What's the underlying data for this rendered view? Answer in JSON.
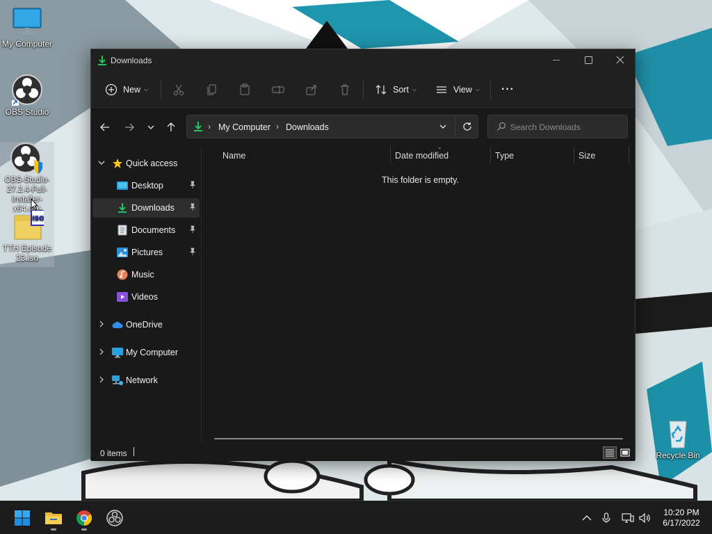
{
  "desktop": {
    "icons": [
      {
        "label": "My Computer",
        "icon": "monitor-icon"
      },
      {
        "label": "OBS Studio",
        "icon": "obs-icon"
      },
      {
        "label": "OBS-Studio-27.2.4-Full-Installer-x64.exe",
        "icon": "obs-installer-icon"
      },
      {
        "label": "TTH Episode 23.iso",
        "icon": "iso-file-icon"
      },
      {
        "label": "Recycle Bin",
        "icon": "recycle-bin-icon"
      }
    ],
    "selected_icon_label_visible": "OBS-Studio-2​7.2.4-Full-Inst​aller-x64.exe"
  },
  "explorer": {
    "title": "Downloads",
    "toolbar": {
      "new_label": "New",
      "sort_label": "Sort",
      "view_label": "View",
      "more_label": "···"
    },
    "address": {
      "segments": [
        "My Computer",
        "Downloads"
      ]
    },
    "search": {
      "placeholder": "Search Downloads"
    },
    "nav": {
      "quick_access": "Quick access",
      "pinned": [
        "Desktop",
        "Downloads",
        "Documents",
        "Pictures"
      ],
      "unpinned": [
        "Music",
        "Videos"
      ],
      "onedrive": "OneDrive",
      "my_computer": "My Computer",
      "network": "Network",
      "active": "Downloads"
    },
    "columns": [
      "Name",
      "Date modified",
      "Type",
      "Size"
    ],
    "empty_message": "This folder is empty.",
    "status": {
      "item_count": "0 items"
    }
  },
  "taskbar": {
    "apps": [
      "start-icon",
      "file-explorer-icon",
      "chrome-icon",
      "obs-icon"
    ],
    "clock": {
      "time": "10:20 PM",
      "date": "6/17/2022"
    }
  },
  "colors": {
    "accent_green": "#22c55e",
    "window_bg": "#191919",
    "titlebar_bg": "#202020",
    "taskbar_bg": "#1c1c1c"
  }
}
